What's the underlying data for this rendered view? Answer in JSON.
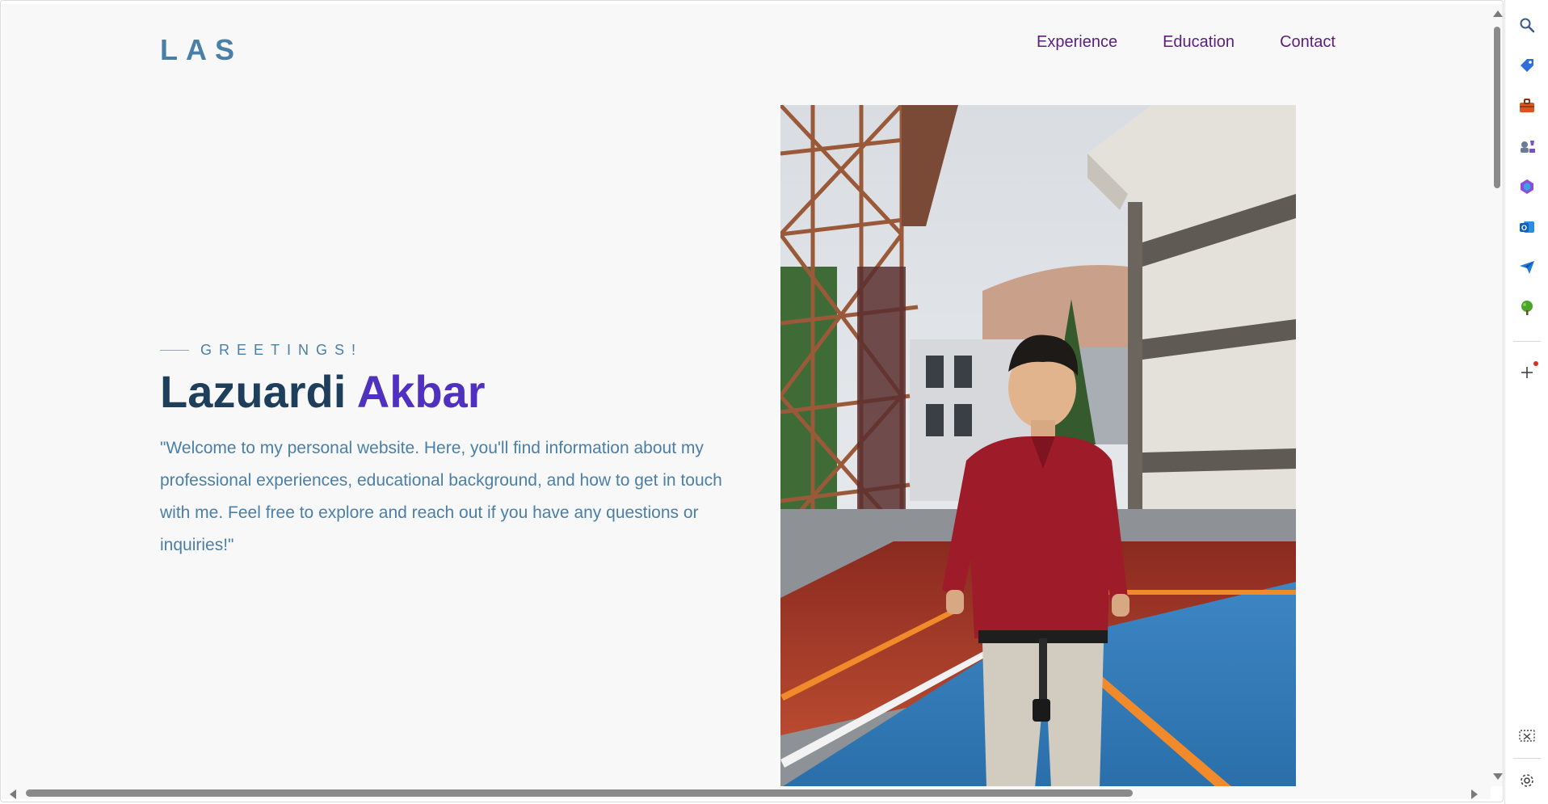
{
  "site": {
    "logo": "LAS",
    "nav": {
      "experience": "Experience",
      "education": "Education",
      "contact": "Contact"
    }
  },
  "hero": {
    "greeting": "GREETINGS!",
    "first_name": "Lazuardi",
    "last_name": "Akbar",
    "intro": "\"Welcome to my personal website. Here, you'll find information about my professional experiences, educational background, and how to get in touch with me. Feel free to explore and reach out if you have any questions or inquiries!\""
  },
  "colors": {
    "logo": "#4a7fa8",
    "nav_link": "#5b1f7a",
    "name_first": "#1e3f5c",
    "name_last": "#5030c0",
    "text": "#4a7fa8"
  },
  "sidebar": {
    "icons": [
      "search-icon",
      "tag-icon",
      "briefcase-icon",
      "games-icon",
      "copilot-icon",
      "outlook-icon",
      "send-icon",
      "tree-icon",
      "add-icon",
      "screenshot-icon",
      "settings-icon"
    ]
  }
}
